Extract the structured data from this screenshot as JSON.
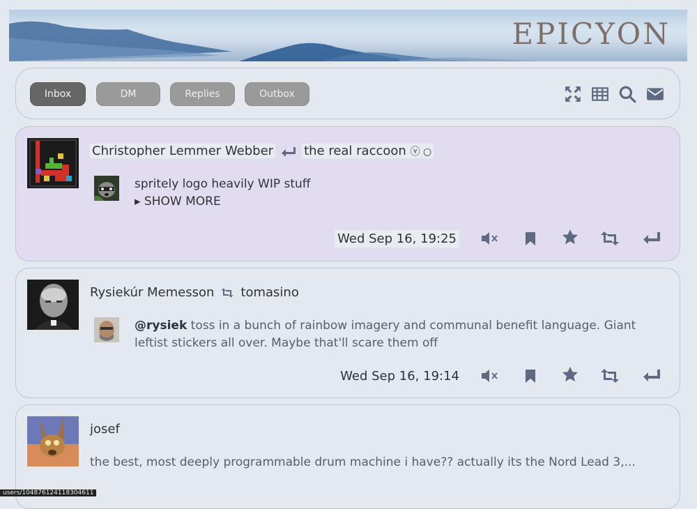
{
  "banner": {
    "title": "EPICYON"
  },
  "toolbar": {
    "tabs": [
      {
        "label": "Inbox",
        "active": true
      },
      {
        "label": "DM",
        "active": false
      },
      {
        "label": "Replies",
        "active": false
      },
      {
        "label": "Outbox",
        "active": false
      }
    ],
    "icons": [
      "fullscreen-icon",
      "calendar-icon",
      "search-icon",
      "new-post-icon"
    ]
  },
  "posts": [
    {
      "author": "Christopher Lemmer Webber",
      "relation_icon": "reply-icon",
      "target": "the real raccoon",
      "target_badges": "ⓥ ○",
      "content": "spritely logo heavily WIP stuff",
      "show_more": "▸ SHOW MORE",
      "timestamp": "Wed Sep 16, 19:25",
      "highlight": true
    },
    {
      "author": "Rysiekúr Memesson",
      "relation_icon": "repeat-icon",
      "target": "tomasino",
      "mention": "@rysiek",
      "content": " toss in a bunch of rainbow imagery and communal benefit language. Giant leftist stickers all over. Maybe that'll scare them off",
      "timestamp": "Wed Sep 16, 19:14",
      "highlight": false
    },
    {
      "author": "josef",
      "content": "the best, most deeply programmable drum machine i have?? actually its the Nord Lead 3,...",
      "highlight": false
    }
  ],
  "status_bar": {
    "url": "users/104876124118304611"
  },
  "colors": {
    "background": "#e3e9ef",
    "highlight_post": "#e2dcf1",
    "icon": "#5f6a82",
    "tab_active": "#666666",
    "tab_inactive": "#9a9a9a"
  }
}
